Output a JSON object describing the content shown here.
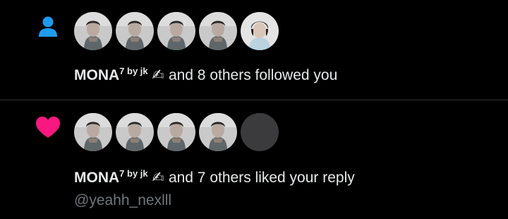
{
  "colors": {
    "background": "#000000",
    "text_primary": "#e7e9ea",
    "text_secondary": "#71767b",
    "follow_icon": "#1d9bf0",
    "like_icon": "#f91880",
    "divider": "#2f3336"
  },
  "notifications": [
    {
      "type": "follow",
      "icon": "person-icon",
      "avatars": [
        "user-photo",
        "user-photo",
        "user-photo",
        "user-photo",
        "user-photo"
      ],
      "actor": {
        "name": "MONA",
        "name_superscript": "7 by jk",
        "name_emoji": "✍"
      },
      "text": "and 8 others followed you"
    },
    {
      "type": "like",
      "icon": "heart-icon",
      "avatars": [
        "user-photo",
        "user-photo",
        "user-photo",
        "user-photo",
        "empty"
      ],
      "actor": {
        "name": "MONA",
        "name_superscript": "7 by jk",
        "name_emoji": "✍"
      },
      "text": "and 7 others liked your reply",
      "quoted_handle": "@yeahh_nexlll"
    }
  ]
}
